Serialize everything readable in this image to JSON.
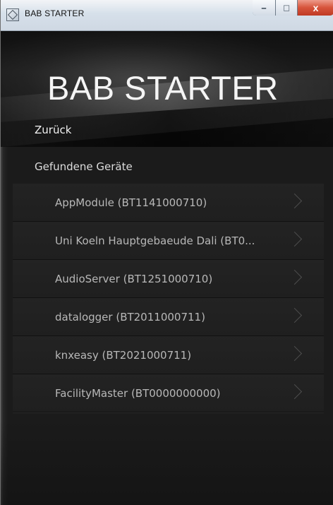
{
  "window": {
    "title": "BAB STARTER",
    "controls": {
      "minimize_symbol": "–",
      "maximize_symbol": "□",
      "close_symbol": "x"
    }
  },
  "header": {
    "title": "BAB STARTER",
    "back_label": "Zurück"
  },
  "devices": {
    "section_title": "Gefundene Geräte",
    "items": [
      "AppModule (BT1141000710)",
      "Uni Koeln Hauptgebaeude Dali (BT0...",
      "AudioServer (BT1251000710)",
      "datalogger (BT2011000711)",
      "knxeasy (BT2021000711)",
      "FacilityMaster (BT0000000000)"
    ]
  },
  "colors": {
    "background": "#1b1b1b",
    "title_bar": "#d6e0ea",
    "close_button": "#d7553c",
    "text_primary": "#f5f5f5",
    "text_secondary": "#b8b8b8"
  }
}
